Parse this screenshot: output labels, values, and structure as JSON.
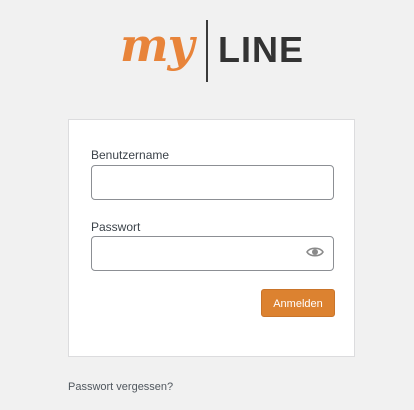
{
  "logo": {
    "my": "my",
    "line": "LINE",
    "accent_color": "#e8843a"
  },
  "form": {
    "username_label": "Benutzername",
    "username_value": "",
    "password_label": "Passwort",
    "password_value": "",
    "submit_label": "Anmelden"
  },
  "links": {
    "lost_password": "Passwort vergessen?"
  },
  "icons": {
    "password_toggle": "eye-icon"
  },
  "colors": {
    "background": "#f1f1f1",
    "button": "#dc8230"
  }
}
